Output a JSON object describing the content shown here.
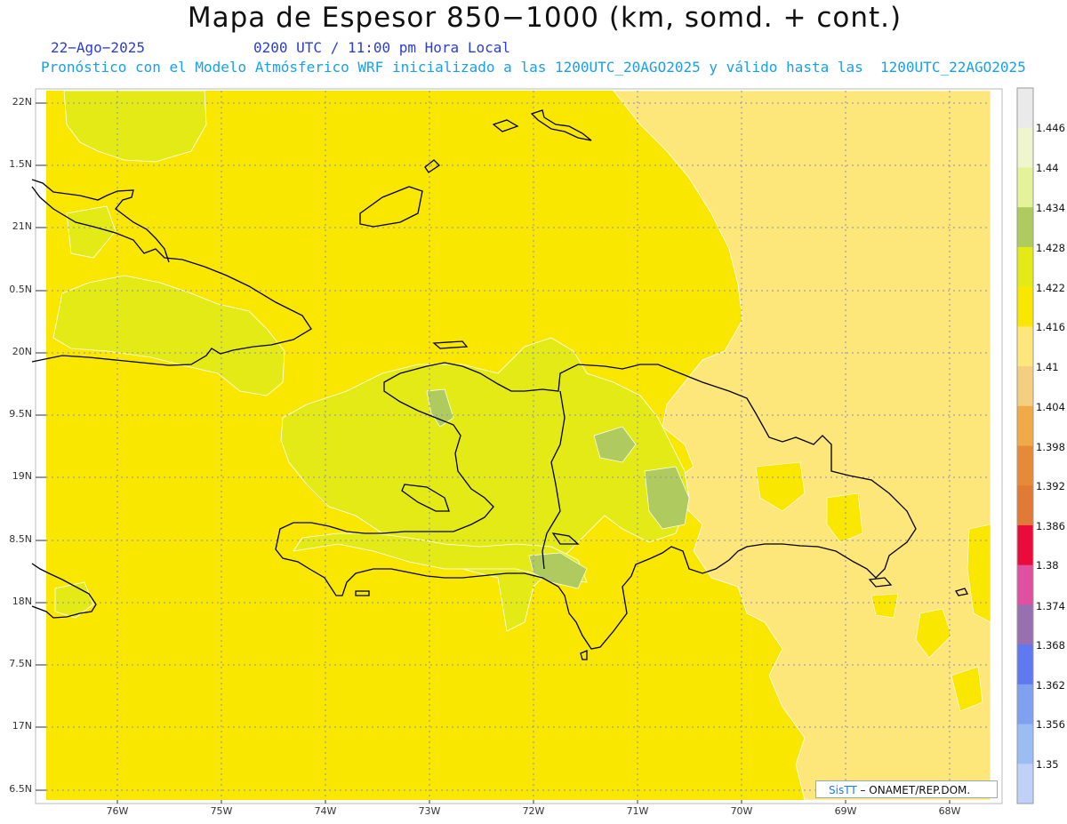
{
  "header": {
    "title": "Mapa de Espesor 850−1000 (km, somd. + cont.)",
    "date": "22−Ago−2025",
    "time": "0200 UTC / 11:00 pm Hora Local",
    "model_line": "Pronóstico con el Modelo Atmósferico WRF inicializado a las 1200UTC_20AGO2025 y válido hasta las  1200UTC_22AGO2025"
  },
  "map": {
    "latitude_labels": [
      "22N",
      "1.5N",
      "21N",
      "0.5N",
      "20N",
      "9.5N",
      "19N",
      "8.5N",
      "18N",
      "7.5N",
      "17N",
      "6.5N"
    ],
    "longitude_labels": [
      "76W",
      "75W",
      "74W",
      "73W",
      "72W",
      "71W",
      "70W",
      "69W",
      "68W"
    ],
    "grid": true,
    "fill_colors": {
      "c_1410_1416": "#fde67a",
      "c_1416_1422": "#fae700",
      "c_1422_1428": "#e3ea16",
      "c_1428_1434": "#afca5e"
    }
  },
  "colorbar": {
    "levels": [
      "1.446",
      "1.44",
      "1.434",
      "1.428",
      "1.422",
      "1.416",
      "1.41",
      "1.404",
      "1.398",
      "1.392",
      "1.386",
      "1.38",
      "1.374",
      "1.368",
      "1.362",
      "1.356",
      "1.35"
    ],
    "colors": [
      "#eaeaea",
      "#eef5cf",
      "#e4f39a",
      "#afca5e",
      "#e3ea16",
      "#fae700",
      "#fde67a",
      "#f4cf80",
      "#f0aa48",
      "#e68a38",
      "#e07a34",
      "#ea0a3c",
      "#e050a0",
      "#9870b0",
      "#6078f0",
      "#80a0f0",
      "#9cbcf4",
      "#c0d0f8"
    ]
  },
  "credit": {
    "logo_text": "SisTT",
    "org_text": "– ONAMET/REP.DOM."
  }
}
